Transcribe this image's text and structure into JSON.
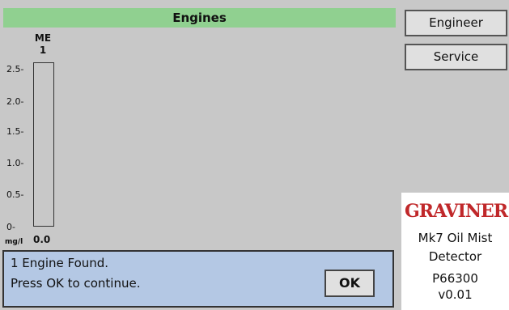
{
  "header": {
    "title": "Engines"
  },
  "engine": {
    "name_line1": "ME",
    "name_line2": "1",
    "value": "0.0",
    "unit": "mg/l",
    "level_fraction": 0.0
  },
  "axis": {
    "ticks": [
      "2.5-",
      "2.0-",
      "1.5-",
      "1.0-",
      "0.5-",
      "0-"
    ]
  },
  "message": {
    "line1": "1 Engine Found.",
    "line2": "Press OK to continue.",
    "ok_label": "OK"
  },
  "sidebar": {
    "engineer_label": "Engineer",
    "service_label": "Service"
  },
  "brand": {
    "logo_text": "GRAVINER",
    "product_line1": "Mk7 Oil Mist",
    "product_line2": "Detector",
    "part_number": "P66300",
    "version": "v0.01",
    "logo_color": "#c0282a"
  },
  "colors": {
    "title_bg": "#90d090",
    "message_bg": "#b4c8e4"
  }
}
